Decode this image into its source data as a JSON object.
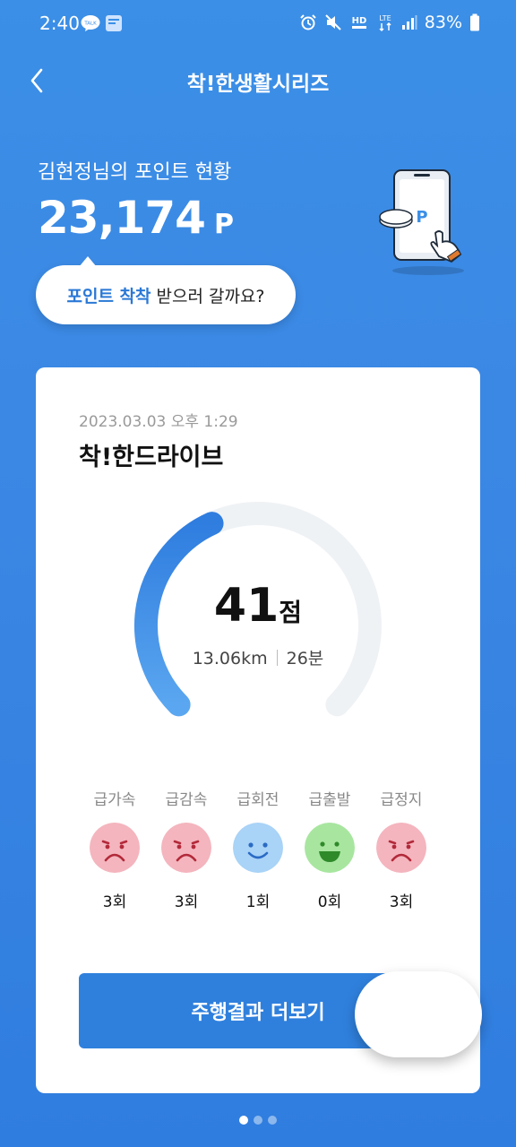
{
  "status_bar": {
    "time": "2:40",
    "talk_badge": "TALK",
    "hd_label": "HD",
    "lte_label": "LTE",
    "battery": "83%"
  },
  "header": {
    "title": "착!한생활시리즈"
  },
  "points": {
    "label": "김현정님의 포인트 현황",
    "value": "23,174",
    "unit": "P",
    "phone_badge": "P"
  },
  "bubble": {
    "highlight": "포인트 착착",
    "rest": "받으러 갈까요?"
  },
  "card": {
    "date": "2023.03.03 오후 1:29",
    "title": "착!한드라이브",
    "score": "41",
    "score_unit": "점",
    "score_fraction": 0.41,
    "distance": "13.06km",
    "duration": "26분",
    "events": [
      {
        "label": "급가속",
        "count": "3회",
        "mood": "sad"
      },
      {
        "label": "급감속",
        "count": "3회",
        "mood": "sad"
      },
      {
        "label": "급회전",
        "count": "1회",
        "mood": "neutral-happy"
      },
      {
        "label": "급출발",
        "count": "0회",
        "mood": "happy"
      },
      {
        "label": "급정지",
        "count": "3회",
        "mood": "sad"
      }
    ],
    "button": "주행결과 더보기"
  },
  "colors": {
    "accent": "#2f80dd",
    "sad_face": "#f4b5be",
    "neutral_face": "#a9d3f7",
    "happy_face": "#a8e6a0"
  },
  "pager": {
    "count": 3,
    "active": 0
  }
}
